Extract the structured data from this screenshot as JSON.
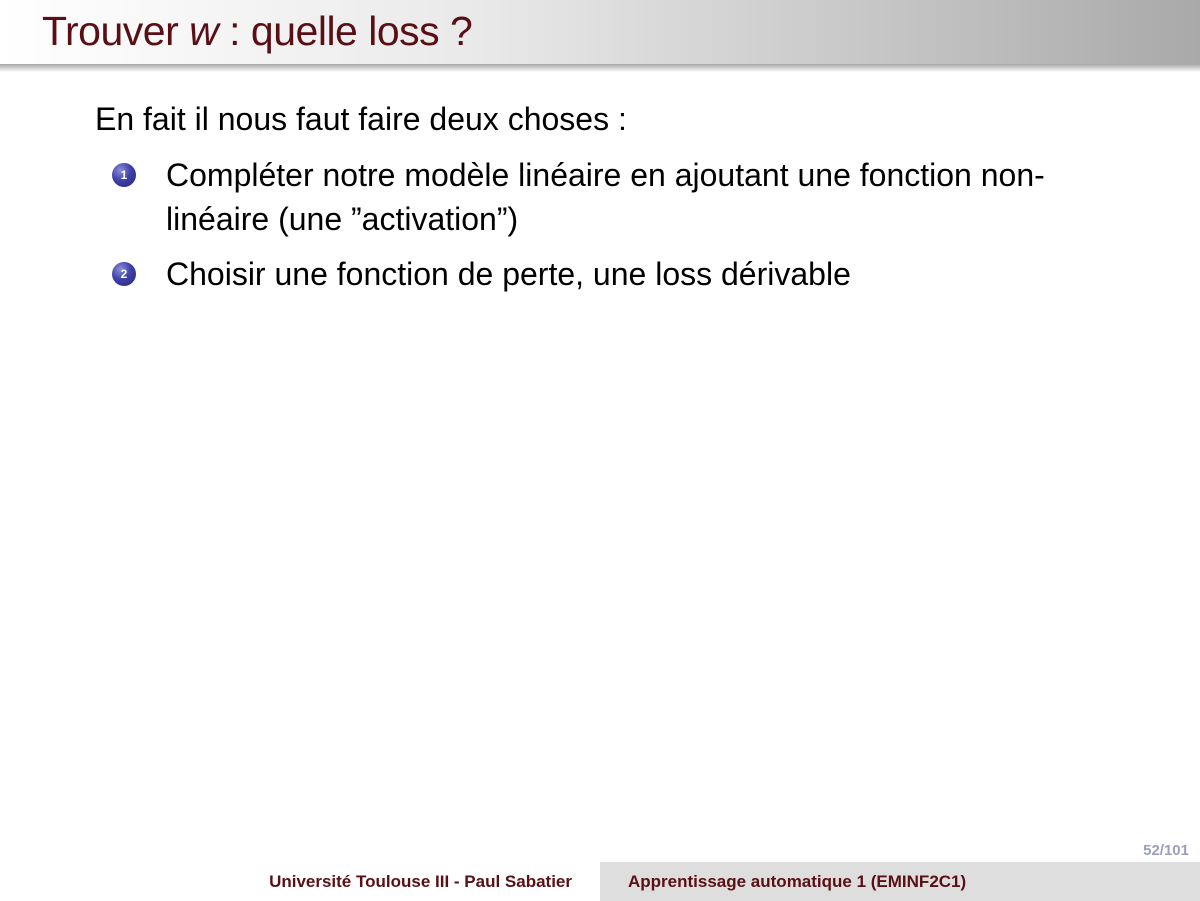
{
  "header": {
    "title_prefix": "Trouver ",
    "title_var": "w",
    "title_suffix": " : quelle loss ?"
  },
  "body": {
    "intro": "En fait il nous faut faire deux choses :",
    "items": [
      {
        "number": "1",
        "text": "Compléter notre modèle linéaire en ajoutant une fonction non-linéaire (une ”activation”)"
      },
      {
        "number": "2",
        "text": "Choisir une fonction de perte, une loss dérivable"
      }
    ]
  },
  "page_number": "52/101",
  "footer": {
    "institution": "Université Toulouse III - Paul Sabatier",
    "course": "Apprentissage automatique 1 (EMINF2C1)"
  },
  "colors": {
    "title": "#5a0f14",
    "bullet": "#3f41a8",
    "page_number": "#9a9fbf"
  }
}
